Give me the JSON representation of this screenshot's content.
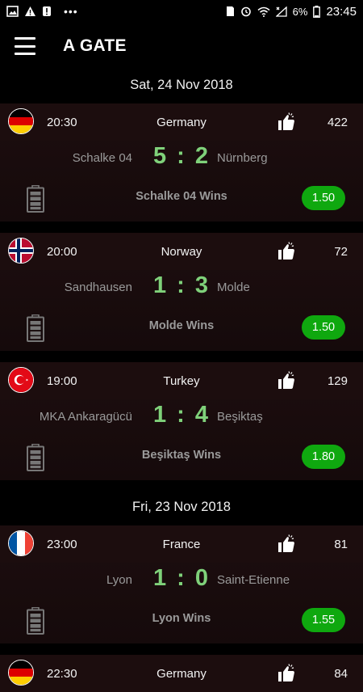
{
  "status_bar": {
    "battery_pct": "6%",
    "time": "23:45"
  },
  "app": {
    "title": "A GATE"
  },
  "colors": {
    "score": "#7fd17a",
    "odds_bg": "#0fa80f",
    "card_bg": "#1c0d0e"
  },
  "groups": [
    {
      "date": "Sat, 24 Nov 2018",
      "matches": [
        {
          "flag": "germany",
          "time": "20:30",
          "country": "Germany",
          "likes": "422",
          "home": "Schalke 04",
          "home_score": "5",
          "away_score": "2",
          "away": "Nürnberg",
          "tip": "Schalke 04 Wins",
          "odds": "1.50"
        },
        {
          "flag": "norway",
          "time": "20:00",
          "country": "Norway",
          "likes": "72",
          "home": "Sandhausen",
          "home_score": "1",
          "away_score": "3",
          "away": "Molde",
          "tip": "Molde Wins",
          "odds": "1.50"
        },
        {
          "flag": "turkey",
          "time": "19:00",
          "country": "Turkey",
          "likes": "129",
          "home": "MKA Ankaragücü",
          "home_score": "1",
          "away_score": "4",
          "away": "Beşiktaş",
          "tip": "Beşiktaş Wins",
          "odds": "1.80"
        }
      ]
    },
    {
      "date": "Fri, 23 Nov 2018",
      "matches": [
        {
          "flag": "france",
          "time": "23:00",
          "country": "France",
          "likes": "81",
          "home": "Lyon",
          "home_score": "1",
          "away_score": "0",
          "away": "Saint-Etienne",
          "tip": "Lyon Wins",
          "odds": "1.55"
        },
        {
          "flag": "germany",
          "time": "22:30",
          "country": "Germany",
          "likes": "84"
        }
      ]
    }
  ]
}
